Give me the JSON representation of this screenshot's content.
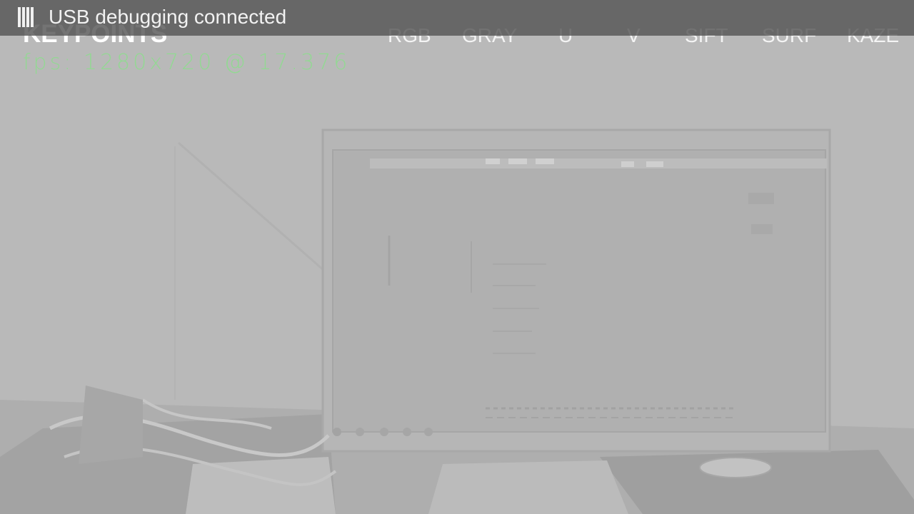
{
  "status_bar": {
    "icon": "usb-debug-icon",
    "text": "USB debugging connected"
  },
  "overlay": {
    "title": "KEYPOINTS",
    "fps_text": "fps: 1280x720 @ 17.376"
  },
  "menu": {
    "items": [
      {
        "label": "RGB"
      },
      {
        "label": "GRAY"
      },
      {
        "label": "U"
      },
      {
        "label": "V"
      },
      {
        "label": "SIFT"
      },
      {
        "label": "SURF"
      },
      {
        "label": "KAZE"
      }
    ]
  },
  "colors": {
    "status_bar_bg": "#555555",
    "fps_text": "#8fdc8f",
    "menu_text": "#f4f4f4",
    "scene_gray": "#b4b4b4"
  }
}
